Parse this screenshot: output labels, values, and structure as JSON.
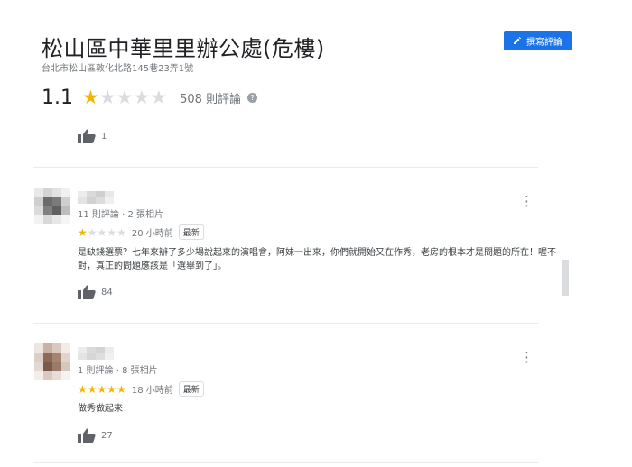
{
  "place": {
    "title": "松山區中華里里辦公處(危樓)",
    "address": "台北市松山區敦化北路145巷23弄1號"
  },
  "write_button": {
    "label": "撰寫評論",
    "icon": "pencil-icon",
    "color": "#1a73e8"
  },
  "summary": {
    "rating": "1.1",
    "stars_filled": 1,
    "stars_total": 5,
    "review_count": "508 則評論",
    "help_icon": "help-icon",
    "like_count": "1"
  },
  "colors": {
    "star": "#f4b400",
    "star_empty": "#dadce0",
    "accent": "#1a73e8"
  },
  "reviews": [
    {
      "meta": "11 則評論 · 2 張相片",
      "stars_filled": 1,
      "time": "20 小時前",
      "badge": "最新",
      "text": "是缺錢選票？七年來辦了多少場說起來的演唱會，阿妹一出來，你們就開始又在作秀，老房的根本才是問題的所在！喔不對，真正的問題應該是「選舉到了」。",
      "likes": "84"
    },
    {
      "meta": "1 則評論 · 8 張相片",
      "stars_filled": 5,
      "time": "18 小時前",
      "badge": "最新",
      "text": "做秀做起來",
      "likes": "27"
    }
  ]
}
